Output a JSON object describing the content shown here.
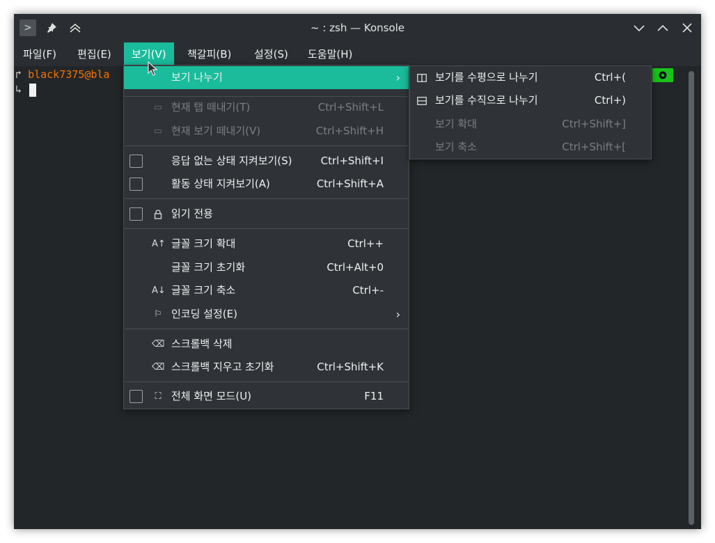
{
  "window": {
    "title": "~ : zsh — Konsole"
  },
  "menubar": {
    "items": [
      {
        "label": "파일(F)"
      },
      {
        "label": "편집(E)"
      },
      {
        "label": "보기(V)"
      },
      {
        "label": "책갈피(B)"
      },
      {
        "label": "설정(S)"
      },
      {
        "label": "도움말(H)"
      }
    ],
    "active": "보기(V)"
  },
  "terminal": {
    "line1_prefix": "↱",
    "line1_prompt": "black7375@bla",
    "line2_prefix": "↳"
  },
  "view_menu": {
    "items": [
      {
        "label": "보기 나누기",
        "shortcut": ""
      },
      {
        "label": "현재 탭 떼내기(T)",
        "shortcut": "Ctrl+Shift+L"
      },
      {
        "label": "현재 보기 떼내기(V)",
        "shortcut": "Ctrl+Shift+H"
      },
      {
        "label": "응답 없는 상태 지켜보기(S)",
        "shortcut": "Ctrl+Shift+I"
      },
      {
        "label": "활동 상태 지켜보기(A)",
        "shortcut": "Ctrl+Shift+A"
      },
      {
        "label": "읽기 전용",
        "shortcut": ""
      },
      {
        "label": "글꼴 크기 확대",
        "shortcut": "Ctrl++"
      },
      {
        "label": "글꼴 크기 초기화",
        "shortcut": "Ctrl+Alt+0"
      },
      {
        "label": "글꼴 크기 축소",
        "shortcut": "Ctrl+-"
      },
      {
        "label": "인코딩 설정(E)",
        "shortcut": ""
      },
      {
        "label": "스크롤백 삭제",
        "shortcut": ""
      },
      {
        "label": "스크롤백 지우고 초기화",
        "shortcut": "Ctrl+Shift+K"
      },
      {
        "label": "전체 화면 모드(U)",
        "shortcut": "F11"
      }
    ]
  },
  "split_submenu": {
    "items": [
      {
        "label": "보기를 수평으로 나누기",
        "shortcut": "Ctrl+("
      },
      {
        "label": "보기를 수직으로 나누기",
        "shortcut": "Ctrl+)"
      },
      {
        "label": "보기 확대",
        "shortcut": "Ctrl+Shift+]"
      },
      {
        "label": "보기 축소",
        "shortcut": "Ctrl+Shift+["
      }
    ]
  },
  "colors": {
    "accent": "#1abc9c",
    "terminal_bg": "#232629",
    "prompt": "#f67400",
    "status_badge": "#18c418"
  }
}
